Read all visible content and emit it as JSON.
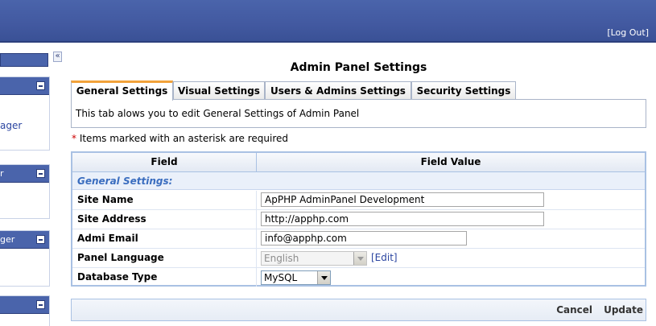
{
  "header": {
    "logout_label": "[Log Out]"
  },
  "sidebar": {
    "panels": [
      {
        "title": "",
        "link": "ager"
      },
      {
        "title": "r",
        "link": ""
      },
      {
        "title": "ger",
        "link": ""
      },
      {
        "title": "",
        "link": ""
      }
    ],
    "collapse_icon": "«"
  },
  "main": {
    "title": "Admin Panel Settings",
    "tabs": [
      {
        "label": "General Settings",
        "active": true
      },
      {
        "label": "Visual Settings",
        "active": false
      },
      {
        "label": "Users & Admins Settings",
        "active": false
      },
      {
        "label": "Security Settings",
        "active": false
      }
    ],
    "tab_description": "This tab alows you to edit General Settings of Admin Panel",
    "required_note": {
      "asterisk": "*",
      "text": " Items marked with an asterisk are required"
    },
    "table": {
      "header_field": "Field",
      "header_value": "Field Value",
      "section_title": "General Settings:",
      "rows": [
        {
          "label": "Site Name",
          "value": "ApPHP AdminPanel Development"
        },
        {
          "label": "Site Address",
          "value": "http://apphp.com"
        },
        {
          "label": "Admi Email",
          "value": "info@apphp.com"
        },
        {
          "label": "Panel Language",
          "value": "English",
          "edit_label": "[Edit]"
        },
        {
          "label": "Database Type",
          "value": "MySQL"
        }
      ]
    },
    "actions": {
      "cancel": "Cancel",
      "update": "Update"
    }
  },
  "colors": {
    "header_bg": "#4259a0",
    "accent_tab": "#f2a23a",
    "section_text": "#3a6dbf",
    "link": "#2a44a0"
  }
}
